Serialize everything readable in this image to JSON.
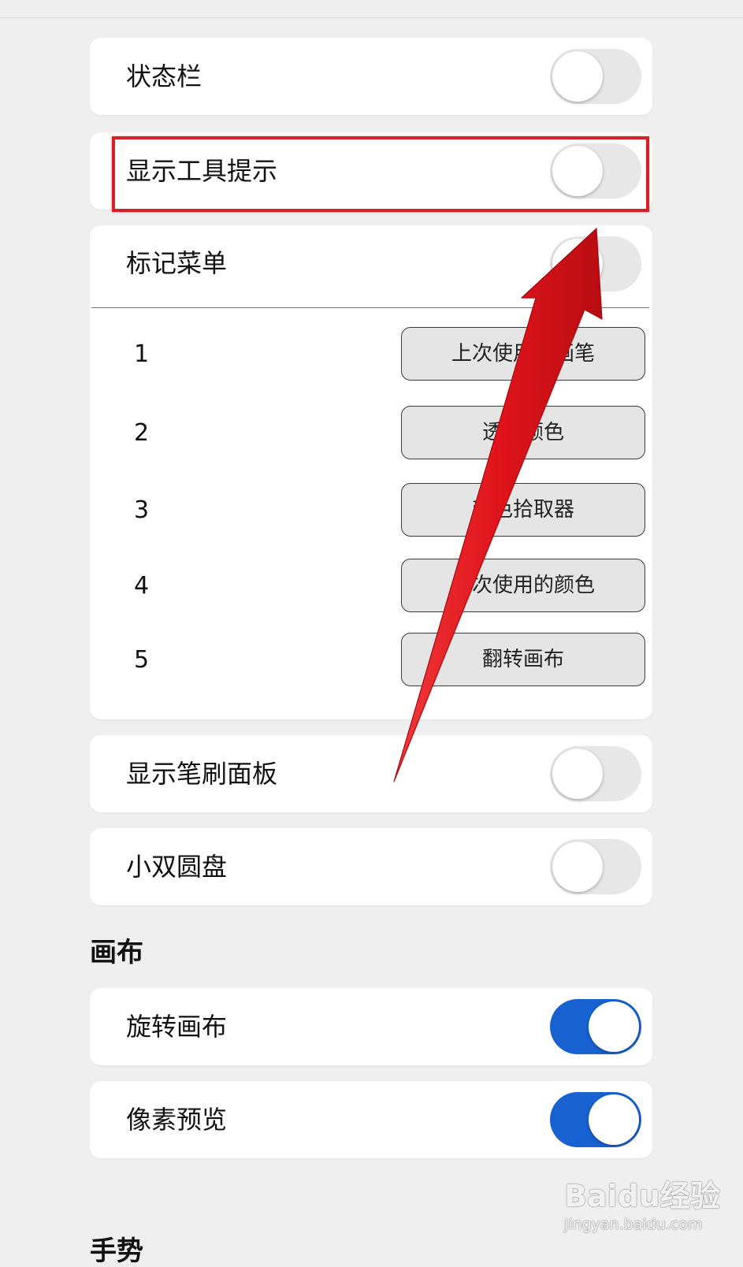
{
  "settings": {
    "status_bar": {
      "label": "状态栏",
      "on": false
    },
    "show_tooltips": {
      "label": "显示工具提示",
      "on": false
    },
    "marking_menu": {
      "label": "标记菜单",
      "on": false,
      "items": [
        {
          "num": "1",
          "action": "上次使用的画笔"
        },
        {
          "num": "2",
          "action": "透明颜色"
        },
        {
          "num": "3",
          "action": "颜色拾取器"
        },
        {
          "num": "4",
          "action": "上次使用的颜色"
        },
        {
          "num": "5",
          "action": "翻转画布"
        }
      ]
    },
    "show_brush_panel": {
      "label": "显示笔刷面板",
      "on": false
    },
    "mini_double_puck": {
      "label": "小双圆盘",
      "on": false
    }
  },
  "canvas_section": {
    "title": "画布",
    "rotate_canvas": {
      "label": "旋转画布",
      "on": true
    },
    "pixel_preview": {
      "label": "像素预览",
      "on": true
    }
  },
  "gestures_section": {
    "title": "手势"
  },
  "watermark": {
    "main": "Baidu经验",
    "sub": "jingyan.baidu.com"
  },
  "colors": {
    "toggle_on": "#1761d1",
    "toggle_off": "#e7e7e7",
    "annotation_red": "#d81f26",
    "background": "#efefef"
  }
}
